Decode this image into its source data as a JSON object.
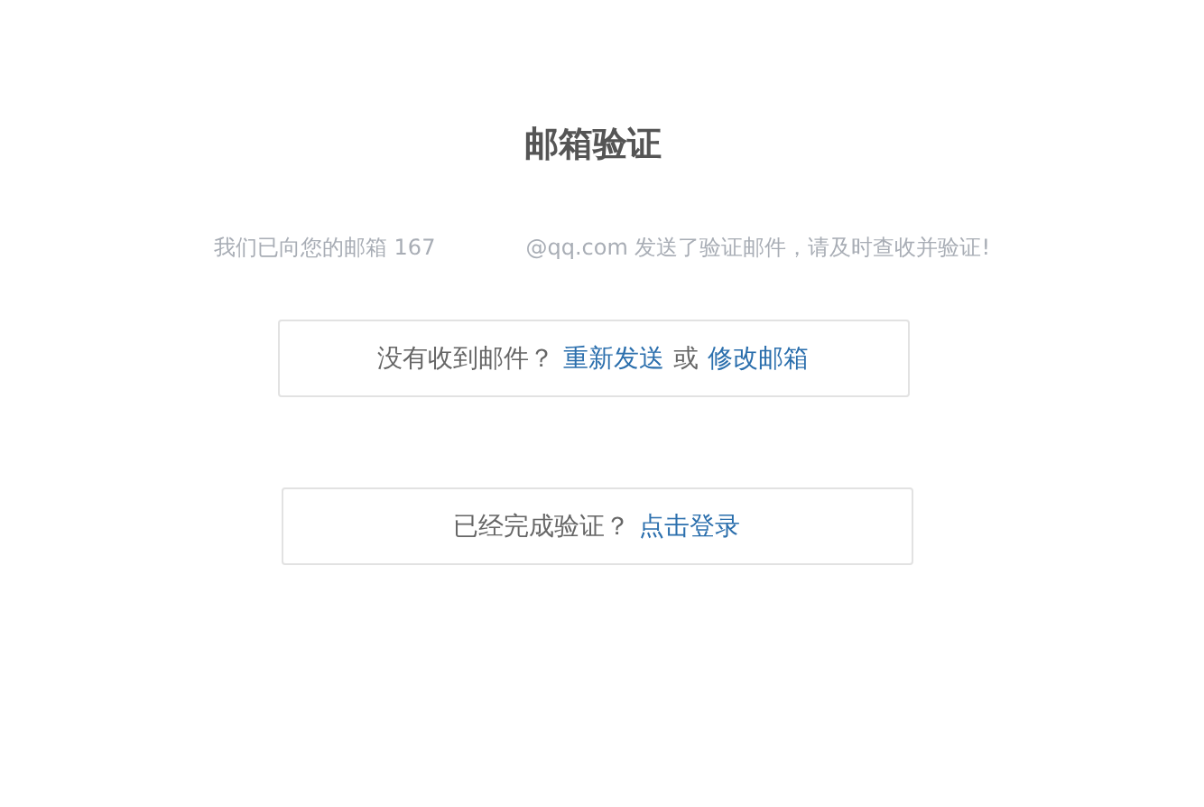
{
  "title": "邮箱验证",
  "message": {
    "before": "我们已向您的邮箱 167",
    "after": "@qq.com 发送了验证邮件，请及时查收并验证!"
  },
  "resend_panel": {
    "prompt": "没有收到邮件？",
    "resend_link": "重新发送",
    "or": "或",
    "change_link": "修改邮箱"
  },
  "login_panel": {
    "prompt": "已经完成验证？",
    "login_link": "点击登录"
  }
}
